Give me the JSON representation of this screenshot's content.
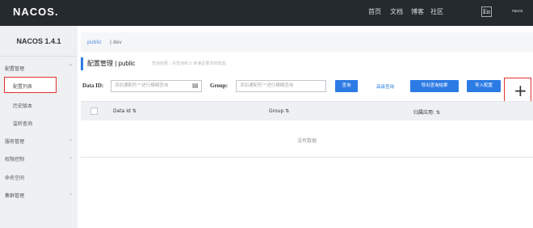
{
  "header": {
    "logo": "NACOS.",
    "nav": [
      "首页",
      "文档",
      "博客",
      "社区"
    ],
    "lang": "En",
    "user": "nacos"
  },
  "sidebar": {
    "title": "NACOS 1.4.1",
    "items": [
      {
        "label": "配置管理",
        "expanded": true
      },
      {
        "label": "配置列表",
        "sub": true,
        "selected": true
      },
      {
        "label": "历史版本",
        "sub": true
      },
      {
        "label": "监听查询",
        "sub": true
      },
      {
        "label": "服务管理"
      },
      {
        "label": "权限控制"
      },
      {
        "label": "命名空间"
      },
      {
        "label": "集群管理"
      }
    ]
  },
  "breadcrumb": {
    "ns": "public",
    "sep": "| dev"
  },
  "main": {
    "title": "配置管理 | public",
    "hint": "查询结果：共查询到 0 条满足要求的配置。",
    "dataid_label": "Data ID:",
    "dataid_placeholder": "添加通配符'*'进行模糊查询",
    "group_label": "Group:",
    "group_placeholder": "添加通配符'*'进行模糊查询",
    "search_btn": "查询",
    "advanced": "高级查询",
    "export_btn": "导出查询结果",
    "import_btn": "导入配置",
    "add_btn": "+"
  },
  "table": {
    "columns": [
      "Data Id  ⇅",
      "Group  ⇅",
      "归属应用:  ⇅"
    ],
    "empty": "没有数据"
  }
}
